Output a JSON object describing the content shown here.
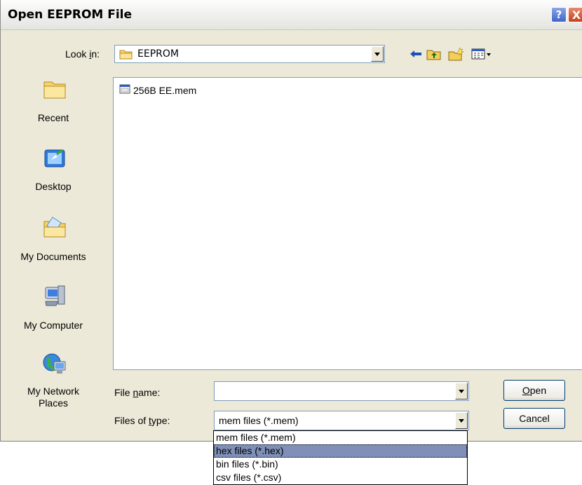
{
  "window": {
    "title": "Open EEPROM File",
    "help_label": "?",
    "close_label": "X"
  },
  "lookin": {
    "label_pre": "Look ",
    "label_key": "i",
    "label_post": "n:",
    "value": "EEPROM"
  },
  "places": [
    {
      "label": "Recent",
      "icon": "recent-folder-icon"
    },
    {
      "label": "Desktop",
      "icon": "desktop-icon"
    },
    {
      "label": "My Documents",
      "icon": "my-documents-icon"
    },
    {
      "label": "My Computer",
      "icon": "my-computer-icon"
    },
    {
      "label_line1": "My Network",
      "label_line2": "Places",
      "icon": "network-places-icon"
    }
  ],
  "files": [
    {
      "name": "256B EE.mem",
      "icon": "mem-file-icon"
    }
  ],
  "filename": {
    "label_pre": "File ",
    "label_key": "n",
    "label_post": "ame:",
    "value": ""
  },
  "filetype": {
    "label_pre": "Files of ",
    "label_key": "t",
    "label_post": "ype:",
    "value": "mem files (*.mem)",
    "options": [
      "mem files (*.mem)",
      "hex files (*.hex)",
      "bin files (*.bin)",
      "csv files (*.csv)"
    ],
    "highlighted_index": 1
  },
  "buttons": {
    "open_key": "O",
    "open_rest": "pen",
    "cancel": "Cancel"
  },
  "colors": {
    "dialog_bg": "#ece9d8",
    "border_blue": "#7f9db9",
    "highlight": "#7f8fb8"
  }
}
